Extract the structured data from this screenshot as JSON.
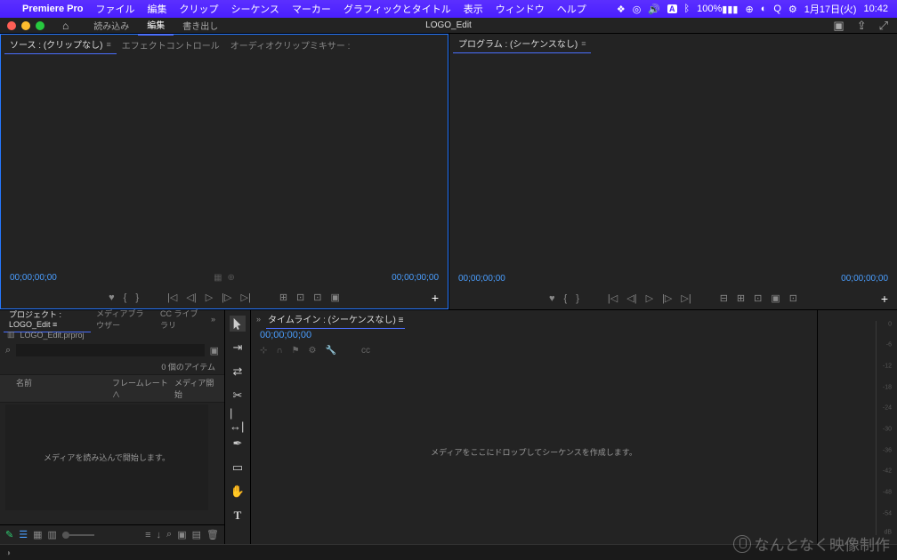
{
  "menubar": {
    "app": "Premiere Pro",
    "items": [
      "ファイル",
      "編集",
      "クリップ",
      "シーケンス",
      "マーカー",
      "グラフィックとタイトル",
      "表示",
      "ウィンドウ",
      "ヘルプ"
    ],
    "battery": "100%",
    "date": "1月17日(火)",
    "time": "10:42"
  },
  "workspace": {
    "tabs": [
      "読み込み",
      "編集",
      "書き出し"
    ],
    "active": 1,
    "title": "LOGO_Edit"
  },
  "source": {
    "tabs": [
      {
        "label": "ソース : (クリップなし)",
        "active": true
      },
      {
        "label": "エフェクトコントロール",
        "active": false
      },
      {
        "label": "オーディオクリップミキサー :",
        "active": false
      }
    ],
    "tc_in": "00;00;00;00",
    "tc_out": "00;00;00;00"
  },
  "program": {
    "tab": "プログラム : (シーケンスなし)",
    "tc_in": "00;00;00;00",
    "tc_out": "00;00;00;00"
  },
  "project": {
    "tabs": [
      {
        "label": "プロジェクト : LOGO_Edit",
        "active": true
      },
      {
        "label": "メディアブラウザー",
        "active": false
      },
      {
        "label": "CC ライブラリ",
        "active": false
      }
    ],
    "file": "LOGO_Edit.prproj",
    "item_count": "0 個のアイテム",
    "cols": {
      "name": "名前",
      "framerate": "フレームレート",
      "media_start": "メディア開始"
    },
    "empty": "メディアを読み込んで開始します。"
  },
  "timeline": {
    "tab": "タイムライン : (シーケンスなし)",
    "tc": "00;00;00;00",
    "empty": "メディアをここにドロップしてシーケンスを作成します。"
  },
  "audio_ticks": [
    "0",
    "-6",
    "-12",
    "-18",
    "-24",
    "-30",
    "-36",
    "-42",
    "-48",
    "-54",
    "dB"
  ],
  "watermark": "なんとなく映像制作"
}
